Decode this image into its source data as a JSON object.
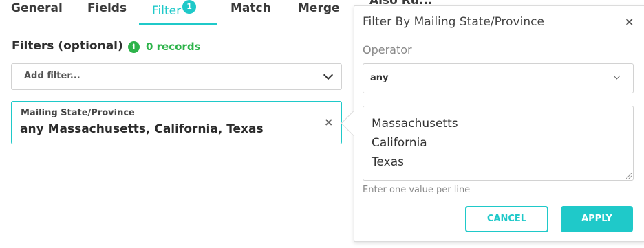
{
  "tabs": [
    {
      "label": "General"
    },
    {
      "label": "Fields"
    },
    {
      "label": "Filter",
      "badge": "1"
    },
    {
      "label": "Match"
    },
    {
      "label": "Merge"
    },
    {
      "label": "Also Ru..."
    }
  ],
  "filters": {
    "title": "Filters (optional)",
    "info_icon": "i",
    "records": "0 records",
    "add_filter_placeholder": "Add filter...",
    "active_filter": {
      "label": "Mailing State/Province",
      "value": "any Massachusetts, California, Texas",
      "remove": "×"
    }
  },
  "popover": {
    "title": "Filter By Mailing State/Province",
    "close": "×",
    "operator_label": "Operator",
    "operator_value": "any",
    "values": [
      "Massachusetts",
      "California",
      "Texas"
    ],
    "hint": "Enter one value per line",
    "cancel_label": "CANCEL",
    "apply_label": "APPLY"
  },
  "colors": {
    "accent": "#1fc9c9",
    "success": "#2db34a"
  }
}
